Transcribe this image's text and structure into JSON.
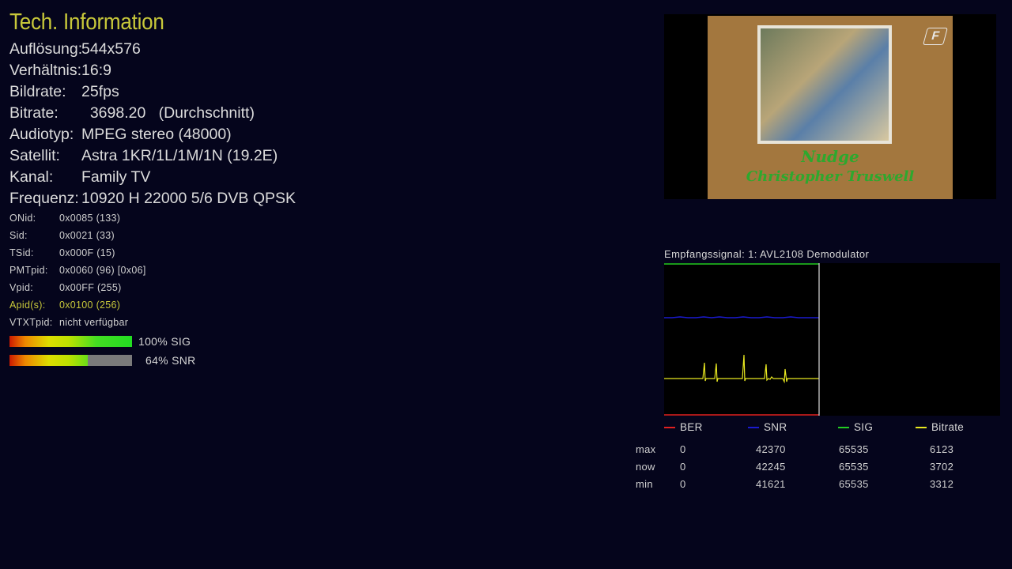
{
  "title": "Tech. Information",
  "main_info": [
    {
      "label": "Auflösung:",
      "value": "544x576"
    },
    {
      "label": "Verhältnis:",
      "value": "16:9"
    },
    {
      "label": "Bildrate:",
      "value": "25fps"
    },
    {
      "label": "Bitrate:",
      "value": "  3698.20   (Durchschnitt)"
    },
    {
      "label": "Audiotyp:",
      "value": "MPEG stereo (48000)"
    },
    {
      "label": "Satellit:",
      "value": "Astra 1KR/1L/1M/1N (19.2E)"
    },
    {
      "label": "Kanal:",
      "value": "Family TV"
    },
    {
      "label": "Frequenz:",
      "value": "10920 H 22000 5/6 DVB QPSK"
    }
  ],
  "pid_info": [
    {
      "label": "ONid:",
      "value": "0x0085 (133)"
    },
    {
      "label": "Sid:",
      "value": "0x0021 (33)"
    },
    {
      "label": "TSid:",
      "value": "0x000F (15)"
    },
    {
      "label": "PMTpid:",
      "value": "0x0060 (96) [0x06]"
    },
    {
      "label": "Vpid:",
      "value": "0x00FF (255)"
    },
    {
      "label": "Apid(s):",
      "value": "0x0100 (256)"
    },
    {
      "label": "VTXTpid:",
      "value": "nicht verfügbar"
    }
  ],
  "signal_bars": {
    "sig": {
      "label": "100% SIG",
      "level": 100
    },
    "snr": {
      "label": "64% SNR",
      "level": 64
    }
  },
  "video_preview": {
    "caption_line1": "Nudge",
    "caption_line2": "Christopher Truswell",
    "logo_icon": "channel-logo-icon"
  },
  "graph": {
    "title": "Empfangssignal: 1: AVL2108 Demodulator",
    "legend": [
      {
        "name": "BER",
        "color": "#e02020"
      },
      {
        "name": "SNR",
        "color": "#1a1ad0"
      },
      {
        "name": "SIG",
        "color": "#22cc22"
      },
      {
        "name": "Bitrate",
        "color": "#e8e820"
      }
    ]
  },
  "stats": {
    "row_labels": [
      "max",
      "now",
      "min"
    ],
    "ber": [
      "0",
      "0",
      "0"
    ],
    "snr": [
      "42370",
      "42245",
      "41621"
    ],
    "sig": [
      "65535",
      "65535",
      "65535"
    ],
    "bitrate": [
      "6123",
      "3702",
      "3312"
    ]
  }
}
